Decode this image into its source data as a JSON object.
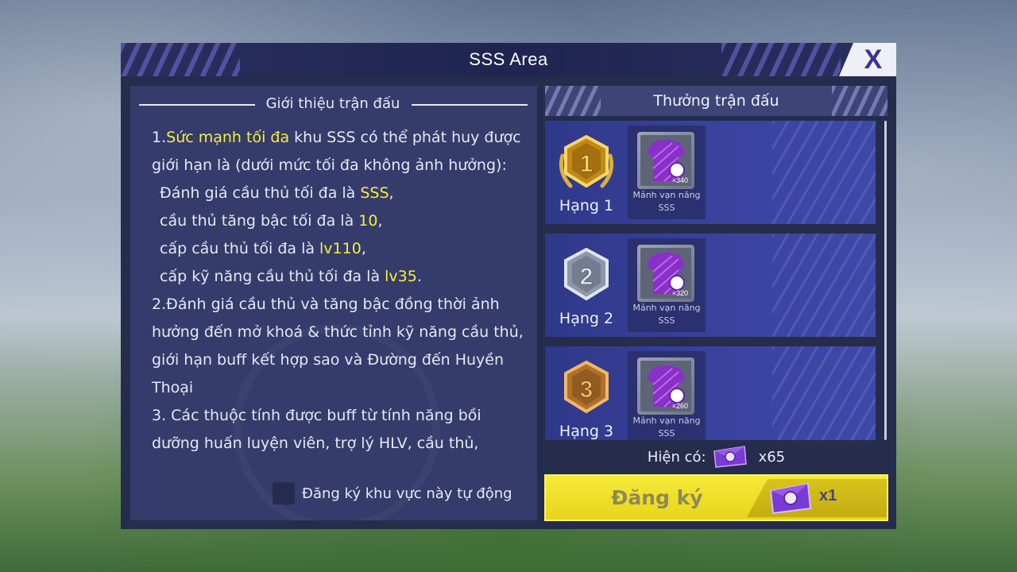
{
  "dialog": {
    "title": "SSS Area",
    "close_label": "X"
  },
  "intro": {
    "header": "Giới thiệu trận đấu",
    "lines": [
      {
        "parts": [
          {
            "t": "1.",
            "hl": false
          },
          {
            "t": "Sức mạnh tối đa",
            "hl": true
          },
          {
            "t": " khu SSS có thể phát huy được",
            "hl": false
          }
        ],
        "indent": false
      },
      {
        "parts": [
          {
            "t": "giới hạn là (dưới mức tối đa không ảnh hưởng):",
            "hl": false
          }
        ],
        "indent": false
      },
      {
        "parts": [
          {
            "t": "Đánh giá cầu thủ tối đa là ",
            "hl": false
          },
          {
            "t": "SSS",
            "hl": true
          },
          {
            "t": ",",
            "hl": false
          }
        ],
        "indent": true
      },
      {
        "parts": [
          {
            "t": "cầu thủ tăng bậc tối đa là ",
            "hl": false
          },
          {
            "t": "10",
            "hl": true
          },
          {
            "t": ",",
            "hl": false
          }
        ],
        "indent": true
      },
      {
        "parts": [
          {
            "t": "cấp cầu thủ tối đa là ",
            "hl": false
          },
          {
            "t": "lv110",
            "hl": true
          },
          {
            "t": ",",
            "hl": false
          }
        ],
        "indent": true
      },
      {
        "parts": [
          {
            "t": "cấp kỹ năng cầu thủ tối đa là ",
            "hl": false
          },
          {
            "t": "lv35",
            "hl": true
          },
          {
            "t": ".",
            "hl": false
          }
        ],
        "indent": true
      },
      {
        "parts": [
          {
            "t": "2.Đánh giá cầu thủ và tăng bậc đồng thời ảnh",
            "hl": false
          }
        ],
        "indent": false
      },
      {
        "parts": [
          {
            "t": "hưởng đến mở khoá & thức tỉnh kỹ năng cầu thủ,",
            "hl": false
          }
        ],
        "indent": false
      },
      {
        "parts": [
          {
            "t": "giới hạn buff kết hợp sao và Đường đến Huyền",
            "hl": false
          }
        ],
        "indent": false
      },
      {
        "parts": [
          {
            "t": "Thoại",
            "hl": false
          }
        ],
        "indent": false
      },
      {
        "parts": [
          {
            "t": "3. Các thuộc tính được buff từ tính năng bồi",
            "hl": false
          }
        ],
        "indent": false
      },
      {
        "parts": [
          {
            "t": "dưỡng huấn luyện viên, trợ lý HLV, cầu thủ,",
            "hl": false
          }
        ],
        "indent": false
      }
    ],
    "auto_register_label": "Đăng ký khu vực này tự động"
  },
  "rewards": {
    "header": "Thưởng trận đấu",
    "ranks": [
      {
        "label": "Hạng 1",
        "number": "1",
        "medal": "gold",
        "item_name_1": "Mảnh vạn năng",
        "item_name_2": "SSS",
        "qty": "×340"
      },
      {
        "label": "Hạng 2",
        "number": "2",
        "medal": "silver",
        "item_name_1": "Mảnh vạn năng",
        "item_name_2": "SSS",
        "qty": "×320"
      },
      {
        "label": "Hạng 3",
        "number": "3",
        "medal": "bronze",
        "item_name_1": "Mảnh vạn năng",
        "item_name_2": "SSS",
        "qty": "×260"
      }
    ]
  },
  "footer": {
    "have_label": "Hiện có:",
    "have_count": "x65",
    "register_label": "Đăng ký",
    "register_cost": "x1"
  },
  "colors": {
    "highlight": "#f8ee3c",
    "gold": "#e3b12c",
    "silver": "#aab2c4",
    "bronze": "#c98a3a",
    "register_button": "#f6ea3a",
    "item_purple": "#8a2fc9"
  }
}
